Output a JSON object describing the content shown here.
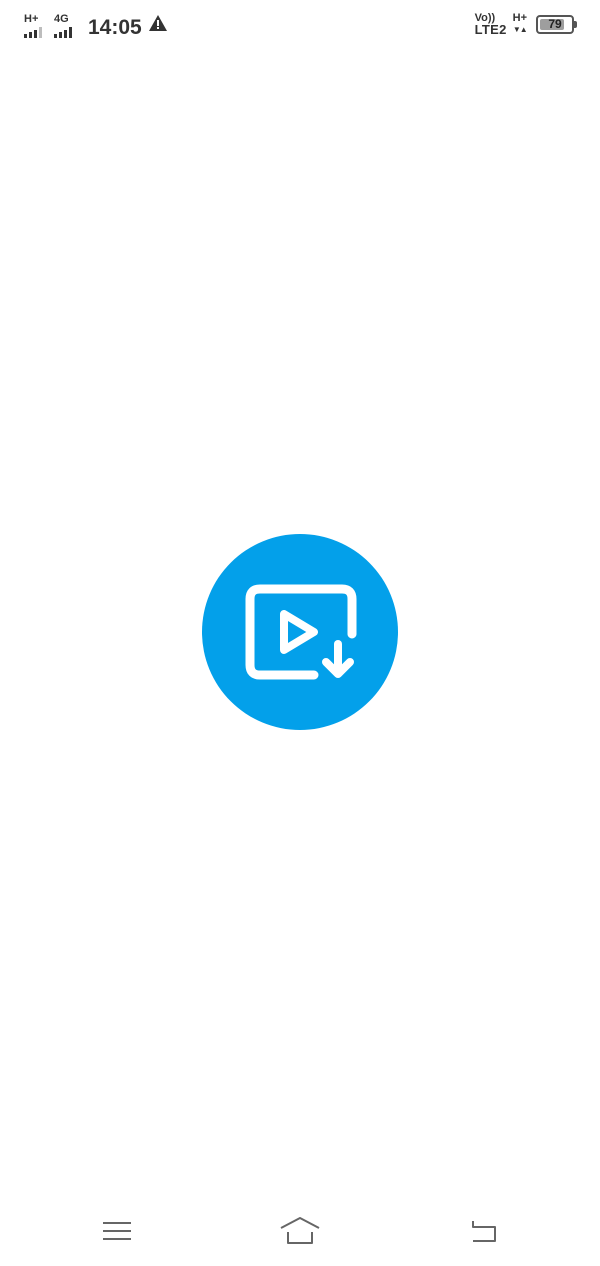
{
  "status_bar": {
    "sim1_type": "H+",
    "sim2_type": "4G",
    "time": "14:05",
    "alert_icon": "warning-triangle-icon",
    "volte_top": "Vo))",
    "volte_bottom": "LTE2",
    "data_type": "H+",
    "data_arrows": "▼▲",
    "battery_level": "79",
    "battery_fraction": 0.79
  },
  "splash": {
    "logo_icon": "video-download-icon",
    "accent_color": "#03a0ea"
  },
  "nav_bar": {
    "menu_icon": "menu-icon",
    "home_icon": "home-icon",
    "back_icon": "back-icon"
  }
}
